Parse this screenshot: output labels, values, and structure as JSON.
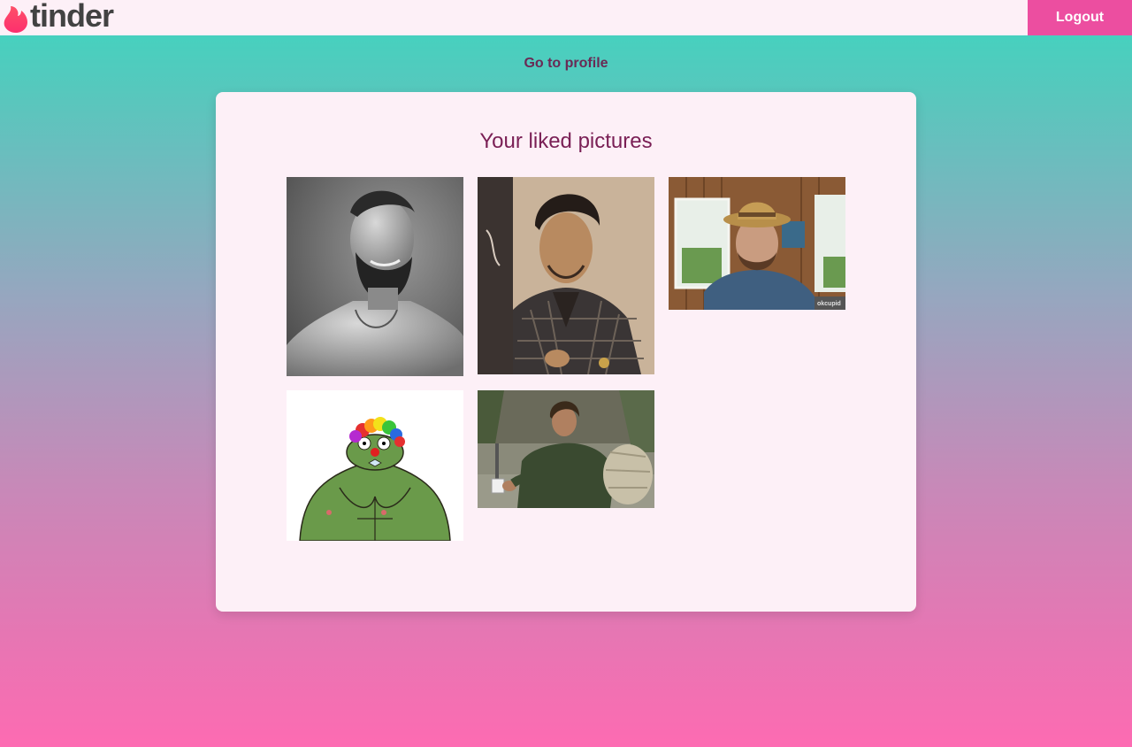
{
  "header": {
    "logo_text": "tinder",
    "logo_icon": "flame-icon",
    "logout_label": "Logout"
  },
  "nav": {
    "profile_link": "Go to profile"
  },
  "liked": {
    "title": "Your liked pictures",
    "pictures": [
      {
        "subject": "grayscale portrait of bearded muscular man"
      },
      {
        "subject": "man with pompadour in plaid jacket selfie"
      },
      {
        "subject": "man in straw hat indoors",
        "watermark": "okcupid"
      },
      {
        "subject": "muscular frog cartoon with rainbow clown wig"
      },
      {
        "subject": "man holding a mug outdoors with sleeping bag"
      }
    ]
  },
  "colors": {
    "topbar_bg": "#fdf0f7",
    "logout_bg": "#ec4ea0",
    "card_bg": "#fdf0f7",
    "title_color": "#7a1f55",
    "gradient_top": "#3dd6c0",
    "gradient_bottom": "#fd6bb2"
  }
}
